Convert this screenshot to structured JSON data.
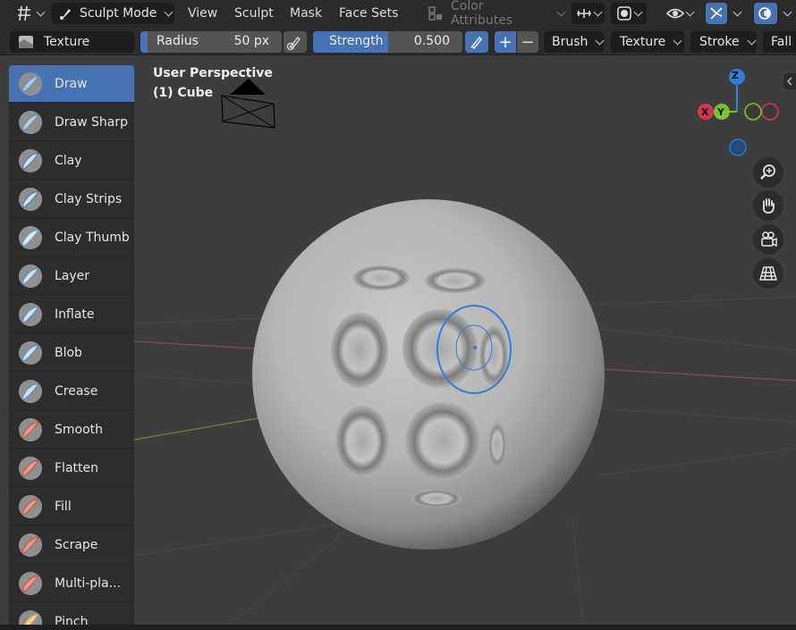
{
  "header": {
    "mode": "Sculpt Mode",
    "menus": [
      "View",
      "Sculpt",
      "Mask",
      "Face Sets"
    ],
    "color_attributes": "Color Attributes"
  },
  "toolheader": {
    "texture_label": "Texture",
    "radius_label": "Radius",
    "radius_value": "50 px",
    "strength_label": "Strength",
    "strength_value": "0.500",
    "strength_fraction": 0.5,
    "plus": "+",
    "minus": "−",
    "dropdowns": [
      "Brush",
      "Texture",
      "Stroke",
      "Fall"
    ]
  },
  "toolbar": {
    "tools": [
      {
        "label": "Draw",
        "active": true,
        "icon": "draw-brush-icon"
      },
      {
        "label": "Draw Sharp",
        "active": false,
        "icon": "draw-sharp-brush-icon"
      },
      {
        "label": "Clay",
        "active": false,
        "icon": "clay-brush-icon"
      },
      {
        "label": "Clay Strips",
        "active": false,
        "icon": "clay-strips-brush-icon"
      },
      {
        "label": "Clay Thumb",
        "active": false,
        "icon": "clay-thumb-brush-icon"
      },
      {
        "label": "Layer",
        "active": false,
        "icon": "layer-brush-icon"
      },
      {
        "label": "Inflate",
        "active": false,
        "icon": "inflate-brush-icon"
      },
      {
        "label": "Blob",
        "active": false,
        "icon": "blob-brush-icon"
      },
      {
        "label": "Crease",
        "active": false,
        "icon": "crease-brush-icon"
      },
      {
        "label": "Smooth",
        "active": false,
        "icon": "smooth-brush-icon"
      },
      {
        "label": "Flatten",
        "active": false,
        "icon": "flatten-brush-icon"
      },
      {
        "label": "Fill",
        "active": false,
        "icon": "fill-brush-icon"
      },
      {
        "label": "Scrape",
        "active": false,
        "icon": "scrape-brush-icon"
      },
      {
        "label": "Multi-pla...",
        "active": false,
        "icon": "multiplane-scrape-brush-icon"
      },
      {
        "label": "Pinch",
        "active": false,
        "icon": "pinch-brush-icon"
      }
    ]
  },
  "viewport": {
    "view_name": "User Perspective",
    "object_name": "(1) Cube"
  },
  "gizmo": {
    "z": "Z",
    "y": "Y",
    "x": "X"
  },
  "colors": {
    "accent": "#4772b3",
    "x_axis": "#d1374f",
    "y_axis": "#7bc32b",
    "z_axis": "#2f7ed8"
  }
}
